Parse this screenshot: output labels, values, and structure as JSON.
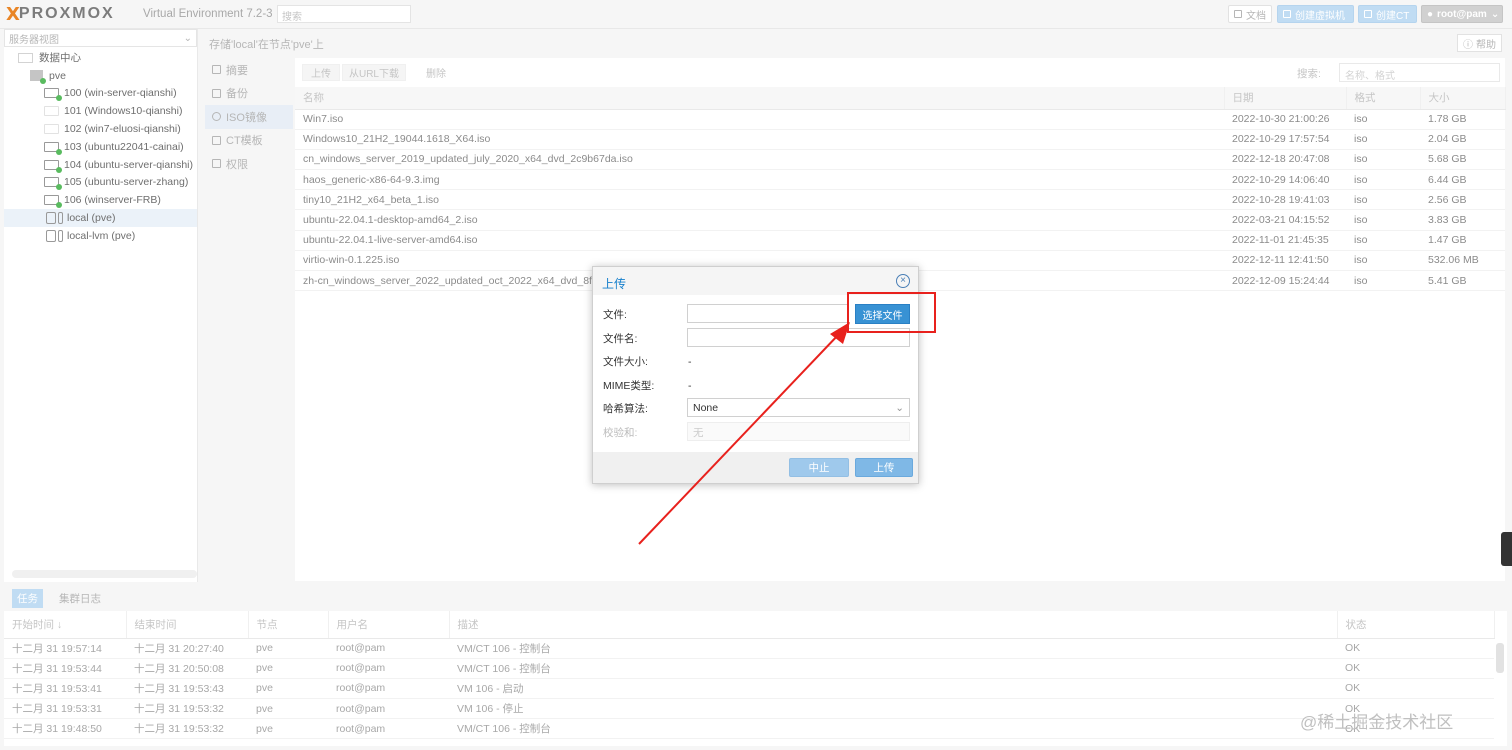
{
  "topbar": {
    "logo_x1": "X",
    "logo_text": "PROXMOX",
    "version": "Virtual Environment 7.2-3",
    "search_placeholder": "搜索",
    "docs_label": "文档",
    "create_vm_label": "创建虚拟机",
    "create_ct_label": "创建CT",
    "user_label": "root@pam"
  },
  "tree": {
    "view_select": "服务器视图",
    "items": [
      {
        "label": "数据中心"
      },
      {
        "label": "pve"
      },
      {
        "label": "100 (win-server-qianshi)"
      },
      {
        "label": "101 (Windows10-qianshi)"
      },
      {
        "label": "102 (win7-eluosi-qianshi)"
      },
      {
        "label": "103 (ubuntu22041-cainai)"
      },
      {
        "label": "104 (ubuntu-server-qianshi)"
      },
      {
        "label": "105 (ubuntu-server-zhang)"
      },
      {
        "label": "106 (winserver-FRB)"
      },
      {
        "label": "local (pve)"
      },
      {
        "label": "local-lvm (pve)"
      }
    ]
  },
  "header": {
    "title": "存储'local'在节点'pve'上",
    "help_label": "帮助"
  },
  "subnav": {
    "items": [
      {
        "label": "摘要"
      },
      {
        "label": "备份"
      },
      {
        "label": "ISO镜像"
      },
      {
        "label": "CT模板"
      },
      {
        "label": "权限"
      }
    ]
  },
  "grid": {
    "toolbar": {
      "upload_label": "上传",
      "download_url_label": "从URL下载",
      "remove_label": "删除",
      "search_label": "搜索:",
      "search_placeholder": "名称、格式"
    },
    "columns": {
      "name": "名称",
      "date": "日期",
      "format": "格式",
      "size": "大小"
    },
    "rows": [
      {
        "name": "Win7.iso",
        "date": "2022-10-30 21:00:26",
        "format": "iso",
        "size": "1.78 GB"
      },
      {
        "name": "Windows10_21H2_19044.1618_X64.iso",
        "date": "2022-10-29 17:57:54",
        "format": "iso",
        "size": "2.04 GB"
      },
      {
        "name": "cn_windows_server_2019_updated_july_2020_x64_dvd_2c9b67da.iso",
        "date": "2022-12-18 20:47:08",
        "format": "iso",
        "size": "5.68 GB"
      },
      {
        "name": "haos_generic-x86-64-9.3.img",
        "date": "2022-10-29 14:06:40",
        "format": "iso",
        "size": "6.44 GB"
      },
      {
        "name": "tiny10_21H2_x64_beta_1.iso",
        "date": "2022-10-28 19:41:03",
        "format": "iso",
        "size": "2.56 GB"
      },
      {
        "name": "ubuntu-22.04.1-desktop-amd64_2.iso",
        "date": "2022-03-21 04:15:52",
        "format": "iso",
        "size": "3.83 GB"
      },
      {
        "name": "ubuntu-22.04.1-live-server-amd64.iso",
        "date": "2022-11-01 21:45:35",
        "format": "iso",
        "size": "1.47 GB"
      },
      {
        "name": "virtio-win-0.1.225.iso",
        "date": "2022-12-11 12:41:50",
        "format": "iso",
        "size": "532.06 MB"
      },
      {
        "name": "zh-cn_windows_server_2022_updated_oct_2022_x64_dvd_8f",
        "date": "2022-12-09 15:24:44",
        "format": "iso",
        "size": "5.41 GB"
      }
    ]
  },
  "tasks": {
    "tab_tasks": "任务",
    "tab_cluster_log": "集群日志",
    "columns": {
      "start": "开始时间 ↓",
      "end": "结束时间",
      "node": "节点",
      "user": "用户名",
      "desc": "描述",
      "status": "状态"
    },
    "rows": [
      {
        "start": "十二月 31 19:57:14",
        "end": "十二月 31 20:27:40",
        "node": "pve",
        "user": "root@pam",
        "desc": "VM/CT 106 - 控制台",
        "status": "OK"
      },
      {
        "start": "十二月 31 19:53:44",
        "end": "十二月 31 20:50:08",
        "node": "pve",
        "user": "root@pam",
        "desc": "VM/CT 106 - 控制台",
        "status": "OK"
      },
      {
        "start": "十二月 31 19:53:41",
        "end": "十二月 31 19:53:43",
        "node": "pve",
        "user": "root@pam",
        "desc": "VM 106 - 启动",
        "status": "OK"
      },
      {
        "start": "十二月 31 19:53:31",
        "end": "十二月 31 19:53:32",
        "node": "pve",
        "user": "root@pam",
        "desc": "VM 106 - 停止",
        "status": "OK"
      },
      {
        "start": "十二月 31 19:48:50",
        "end": "十二月 31 19:53:32",
        "node": "pve",
        "user": "root@pam",
        "desc": "VM/CT 106 - 控制台",
        "status": "OK"
      }
    ]
  },
  "dialog": {
    "title": "上传",
    "file_label": "文件:",
    "choose_file_label": "选择文件",
    "filename_label": "文件名:",
    "filesize_label": "文件大小:",
    "filesize_value": "-",
    "mime_label": "MIME类型:",
    "mime_value": "-",
    "hash_label": "哈希算法:",
    "hash_value": "None",
    "checksum_label": "校验和:",
    "checksum_placeholder": "无",
    "abort_label": "中止",
    "upload_label": "上传"
  },
  "watermark": "@稀土掘金技术社区",
  "colors": {
    "accent": "#157fcc",
    "annotation": "#e8211d",
    "logo": "#e57000"
  }
}
